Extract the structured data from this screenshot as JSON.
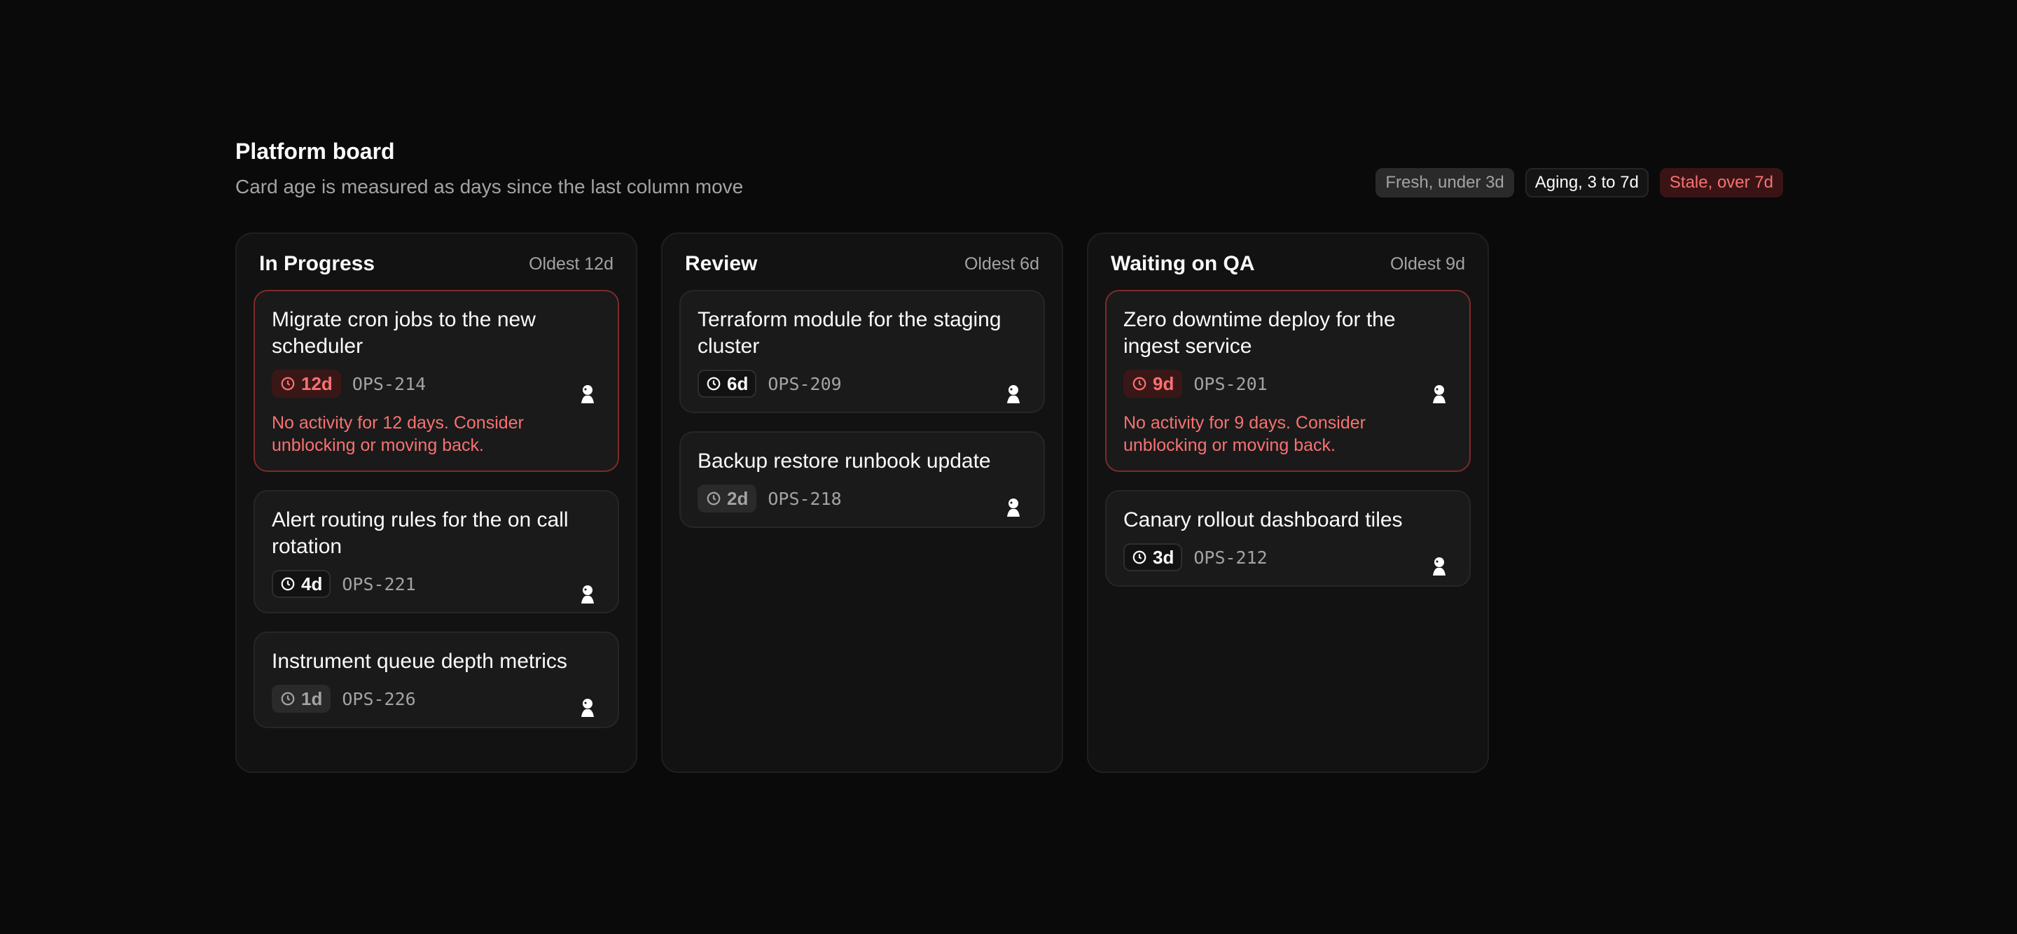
{
  "board": {
    "title": "Platform board",
    "subtitle": "Card age is measured as days since the last column move"
  },
  "legend": {
    "fresh": "Fresh, under 3d",
    "aging": "Aging, 3 to 7d",
    "stale": "Stale, over 7d"
  },
  "colors": {
    "background": "#0a0a0a",
    "column": "#121212",
    "card": "#1a1a1a",
    "stale": "#f87171",
    "stale_border": "#7f2a2a",
    "muted": "#a3a3a3"
  },
  "columns": [
    {
      "name": "In Progress",
      "oldest": "Oldest 12d",
      "cards": [
        {
          "title": "Migrate cron jobs to the new scheduler",
          "age": "12d",
          "ticket": "OPS-214",
          "warning": "No activity for 12 days. Consider unblocking or moving back."
        },
        {
          "title": "Alert routing rules for the on call rotation",
          "age": "4d",
          "ticket": "OPS-221"
        },
        {
          "title": "Instrument queue depth metrics",
          "age": "1d",
          "ticket": "OPS-226"
        }
      ]
    },
    {
      "name": "Review",
      "oldest": "Oldest 6d",
      "cards": [
        {
          "title": "Terraform module for the staging cluster",
          "age": "6d",
          "ticket": "OPS-209"
        },
        {
          "title": "Backup restore runbook update",
          "age": "2d",
          "ticket": "OPS-218"
        }
      ]
    },
    {
      "name": "Waiting on QA",
      "oldest": "Oldest 9d",
      "cards": [
        {
          "title": "Zero downtime deploy for the ingest service",
          "age": "9d",
          "ticket": "OPS-201",
          "warning": "No activity for 9 days. Consider unblocking or moving back."
        },
        {
          "title": "Canary rollout dashboard tiles",
          "age": "3d",
          "ticket": "OPS-212"
        }
      ]
    }
  ]
}
